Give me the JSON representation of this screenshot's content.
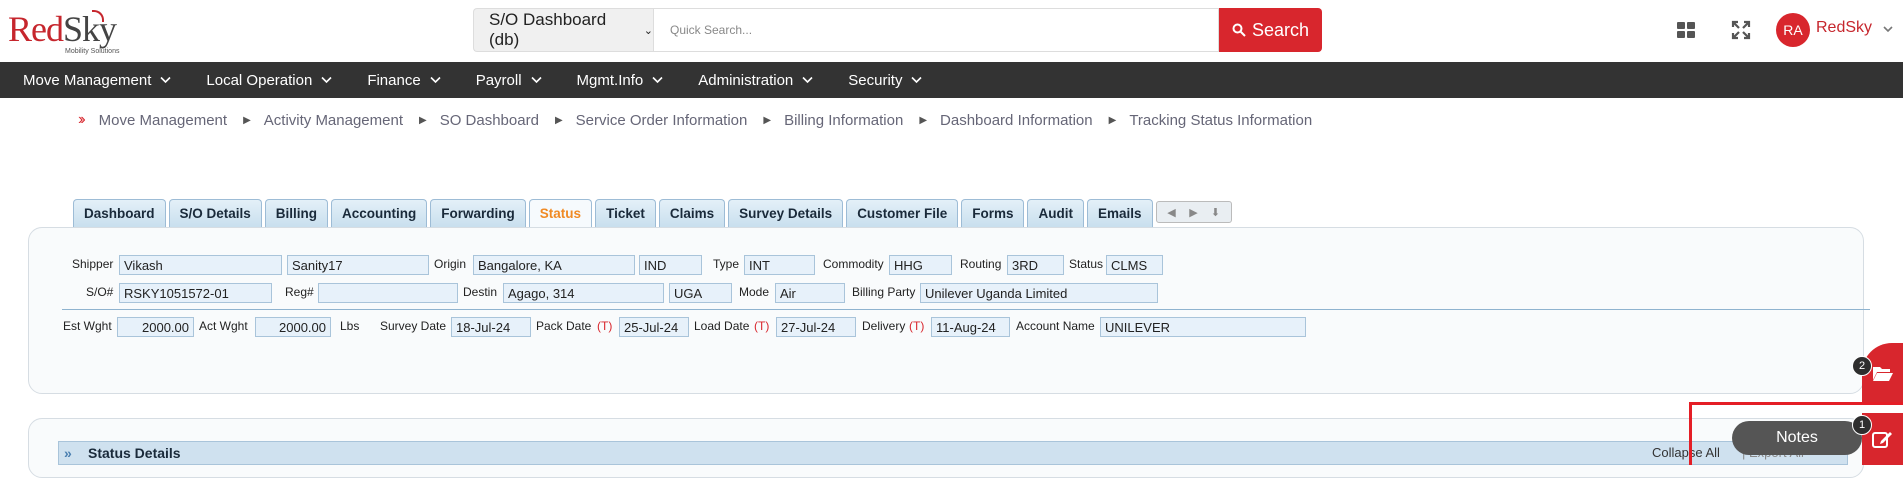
{
  "brand": {
    "name_red": "Red",
    "name_dark": "Sky",
    "tagline": "Mobility Solutions",
    "accent": "#c6262d"
  },
  "search": {
    "scope": "S/O Dashboard (db)",
    "placeholder": "Quick Search...",
    "button_label": "Search"
  },
  "header": {
    "icons": [
      "grid-icon",
      "fullscreen-icon"
    ],
    "avatar_initials": "RA",
    "user_name": "RedSky"
  },
  "nav": [
    {
      "label": "Move Management"
    },
    {
      "label": "Local Operation"
    },
    {
      "label": "Finance"
    },
    {
      "label": "Payroll"
    },
    {
      "label": "Mgmt.Info"
    },
    {
      "label": "Administration"
    },
    {
      "label": "Security"
    }
  ],
  "breadcrumb": [
    "Move Management",
    "Activity Management",
    "SO Dashboard",
    "Service Order Information",
    "Billing Information",
    "Dashboard Information",
    "Tracking Status Information"
  ],
  "tabs": [
    {
      "label": "Dashboard"
    },
    {
      "label": "S/O Details"
    },
    {
      "label": "Billing"
    },
    {
      "label": "Accounting"
    },
    {
      "label": "Forwarding"
    },
    {
      "label": "Status",
      "active": true
    },
    {
      "label": "Ticket"
    },
    {
      "label": "Claims"
    },
    {
      "label": "Survey Details"
    },
    {
      "label": "Customer File"
    },
    {
      "label": "Forms"
    },
    {
      "label": "Audit"
    },
    {
      "label": "Emails"
    }
  ],
  "info": {
    "shipper_label": "Shipper",
    "shipper_first": "Vikash",
    "shipper_last": "Sanity17",
    "origin_label": "Origin",
    "origin_city": "Bangalore, KA",
    "origin_country": "IND",
    "type_label": "Type",
    "type": "INT",
    "commodity_label": "Commodity",
    "commodity": "HHG",
    "routing_label": "Routing",
    "routing": "3RD",
    "status_label": "Status",
    "status": "CLMS",
    "so_label": "S/O#",
    "so_number": "RSKY1051572-01",
    "reg_label": "Reg#",
    "reg_number": "",
    "destin_label": "Destin",
    "destin_city": "Agago, 314",
    "destin_country": "UGA",
    "mode_label": "Mode",
    "mode": "Air",
    "billing_party_label": "Billing Party",
    "billing_party": "Unilever Uganda Limited",
    "est_wght_label": "Est Wght",
    "est_wght": "2000.00",
    "act_wght_label": "Act Wght",
    "act_wght": "2000.00",
    "unit": "Lbs",
    "survey_date_label": "Survey Date",
    "survey_date": "18-Jul-24",
    "pack_date_label": "Pack Date",
    "pack_date": "25-Jul-24",
    "load_date_label": "Load Date",
    "load_date": "27-Jul-24",
    "delivery_label": "Delivery",
    "delivery": "11-Aug-24",
    "tentative_marker": "(T)",
    "account_name_label": "Account Name",
    "account_name": "UNILEVER"
  },
  "status_details": {
    "title": "Status Details",
    "collapse_label": "Collapse All",
    "export_label": "| Export All"
  },
  "floating": {
    "notes_label": "Notes",
    "folder_badge": "2",
    "notes_badge": "1"
  }
}
